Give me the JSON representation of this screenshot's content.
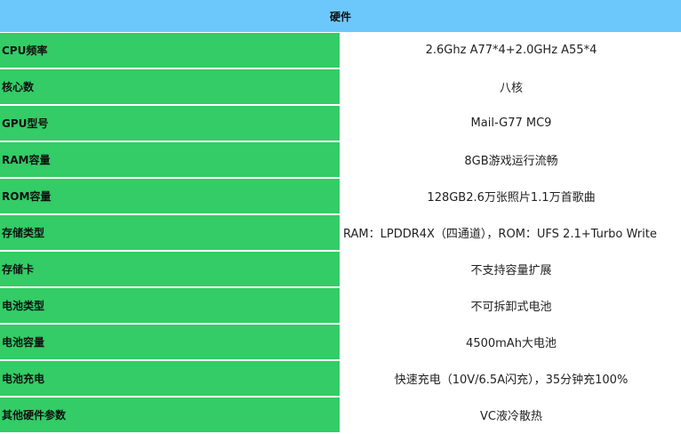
{
  "table": {
    "header": "硬件",
    "rows": [
      {
        "label": "CPU频率",
        "value": "2.6Ghz A77*4+2.0GHz A55*4"
      },
      {
        "label": "核心数",
        "value": "八核"
      },
      {
        "label": "GPU型号",
        "value": "Mail-G77 MC9"
      },
      {
        "label": "RAM容量",
        "value": "8GB游戏运行流畅"
      },
      {
        "label": "ROM容量",
        "value": "128GB2.6万张照片1.1万首歌曲"
      },
      {
        "label": "存储类型",
        "value": "RAM：LPDDR4X（四通道），ROM：UFS 2.1+Turbo Write"
      },
      {
        "label": "存储卡",
        "value": "不支持容量扩展"
      },
      {
        "label": "电池类型",
        "value": "不可拆卸式电池"
      },
      {
        "label": "电池容量",
        "value": "4500mAh大电池"
      },
      {
        "label": "电池充电",
        "value": "快速充电（10V/6.5A闪充），35分钟充100%"
      },
      {
        "label": "其他硬件参数",
        "value": "VC液冷散热"
      }
    ]
  },
  "colors": {
    "header_bg": "#6cc8fb",
    "label_bg": "#33cc66"
  }
}
